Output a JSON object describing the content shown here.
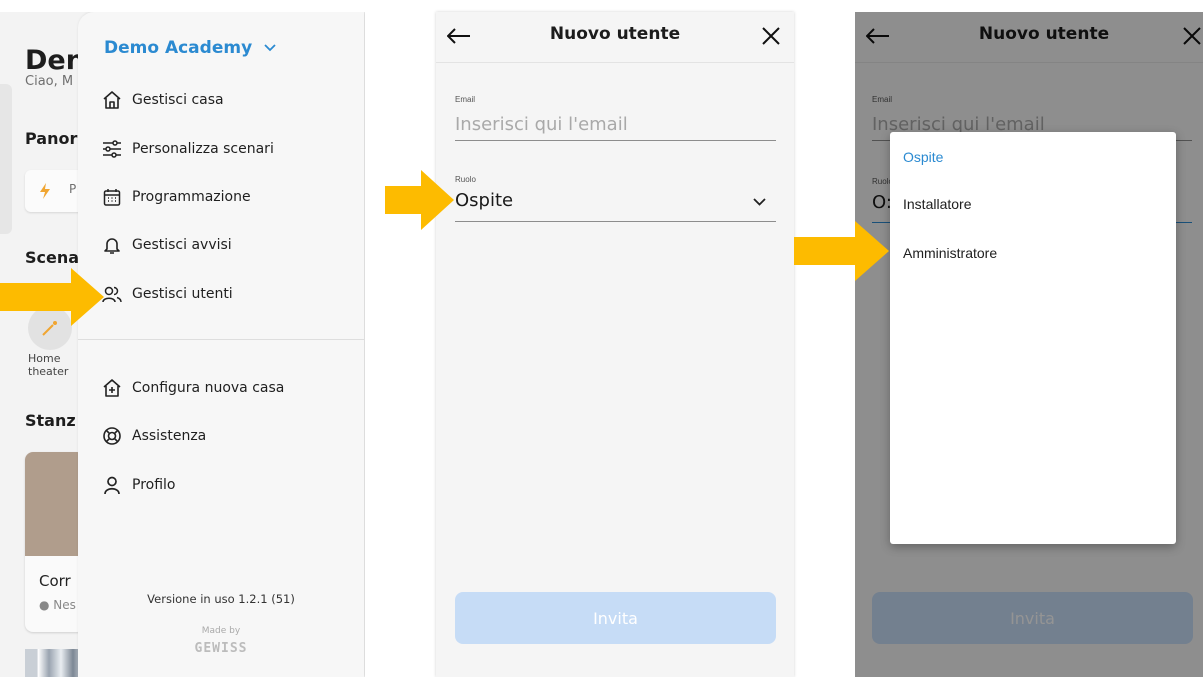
{
  "home": {
    "title_fragment": "Den",
    "greeting_fragment": "Ciao, M",
    "overview_fragment": "Panor",
    "scenes_fragment": "Scena",
    "scene_tile_label": "Home theater",
    "rooms_fragment": "Stanz",
    "room_card_fragment": "Corr",
    "room_status_fragment": "● Nes"
  },
  "drawer": {
    "home_name": "Demo Academy",
    "items": [
      {
        "label": "Gestisci casa"
      },
      {
        "label": "Personalizza scenari"
      },
      {
        "label": "Programmazione"
      },
      {
        "label": "Gestisci avvisi"
      },
      {
        "label": "Gestisci utenti"
      },
      {
        "label": "Configura nuova casa"
      },
      {
        "label": "Assistenza"
      },
      {
        "label": "Profilo"
      }
    ],
    "version": "Versione in uso 1.2.1 (51)",
    "made_by": "Made by",
    "brand": "GEWISS"
  },
  "new_user": {
    "title": "Nuovo utente",
    "email_label": "Email",
    "email_placeholder": "Inserisci qui l'email",
    "role_label": "Ruolo",
    "role_value": "Ospite",
    "invite_button": "Invita"
  },
  "role_menu": {
    "options": [
      "Ospite",
      "Installatore",
      "Amministratore"
    ],
    "selected": "Ospite",
    "partial_role_value": "O:"
  },
  "colors": {
    "accent": "#2b8ad1",
    "arrow": "#fdbb00",
    "button_disabled": "#c6dcf6"
  }
}
